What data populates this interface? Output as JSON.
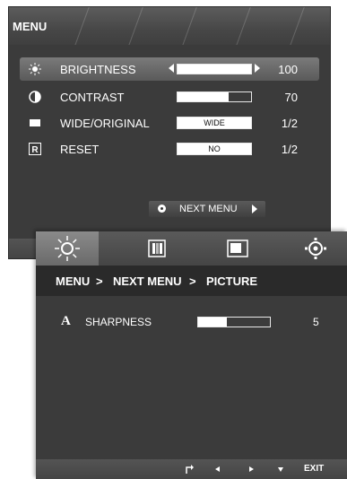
{
  "menu": {
    "title": "MENU",
    "items": [
      {
        "label": "BRIGHTNESS",
        "value": "100",
        "level": 1.0
      },
      {
        "label": "CONTRAST",
        "value": "70",
        "level": 0.7
      },
      {
        "label": "WIDE/ORIGINAL",
        "value": "1/2",
        "option": "WIDE"
      },
      {
        "label": "RESET",
        "value": "1/2",
        "option": "NO"
      }
    ],
    "next_menu": "NEXT MENU"
  },
  "submenu": {
    "breadcrumb": [
      "MENU",
      ">",
      "NEXT MENU",
      ">",
      "PICTURE"
    ],
    "tabs": [
      "picture-icon",
      "color-icon",
      "display-icon",
      "other-settings-icon"
    ],
    "sharpness": {
      "label": "SHARPNESS",
      "glyph": "A",
      "value": "5",
      "level": 0.4
    },
    "footer": {
      "exit": "EXIT"
    }
  },
  "colors": {
    "panel": "#3b3b3b",
    "highlight": "#6a6a6a",
    "text": "#ffffff"
  }
}
